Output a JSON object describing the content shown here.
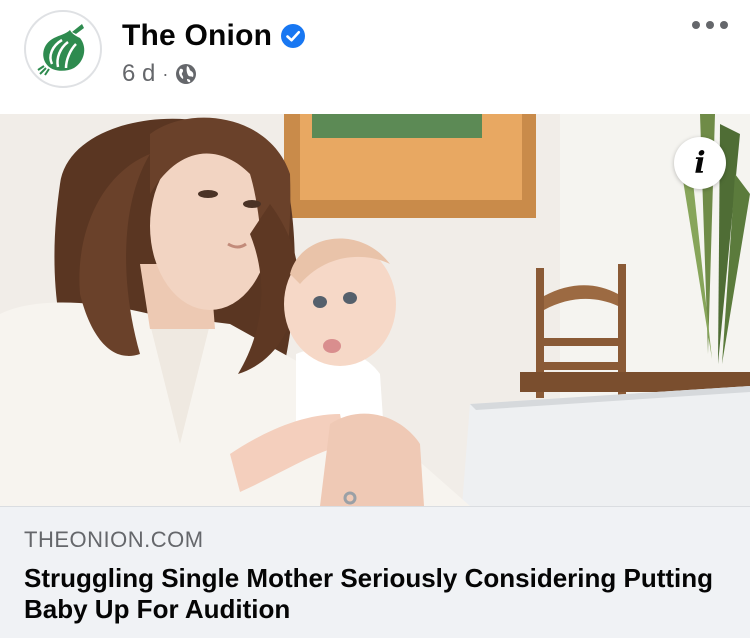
{
  "post": {
    "page_name": "The Onion",
    "verified": true,
    "timestamp": "6 d",
    "separator": "·",
    "audience_icon": "globe-icon",
    "more_icon": "more-options-icon",
    "avatar_icon": "onion-logo-icon"
  },
  "link_preview": {
    "image_alt": "Mother holding baby looking at laptop",
    "info_glyph": "i",
    "domain": "THEONION.COM",
    "title": "Struggling Single Mother Seriously Considering Putting Baby Up For Audition"
  },
  "colors": {
    "brand_green": "#2e8b4f",
    "verified_blue": "#1877f2",
    "secondary_text": "#65676b",
    "footer_bg": "#f0f2f5"
  }
}
